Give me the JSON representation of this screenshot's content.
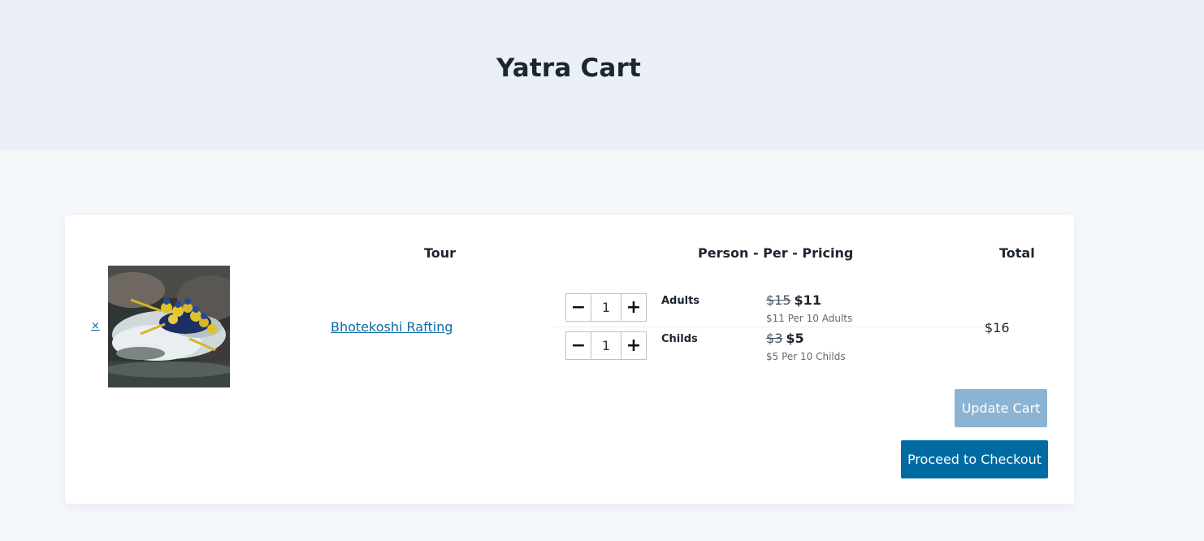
{
  "page": {
    "title": "Yatra Cart"
  },
  "table": {
    "headers": {
      "tour": "Tour",
      "pricing": "Person - Per - Pricing",
      "total": "Total"
    }
  },
  "cart_item": {
    "remove_label": "×",
    "tour_name": "Bhotekoshi Rafting",
    "total": "$16",
    "pricing": [
      {
        "label": "Adults",
        "quantity": "1",
        "old_price": "$15",
        "new_price": "$11",
        "note": "$11 Per 10 Adults"
      },
      {
        "label": "Childs",
        "quantity": "1",
        "old_price": "$3",
        "new_price": "$5",
        "note": "$5 Per 10 Childs"
      }
    ]
  },
  "stepper": {
    "minus": "−",
    "plus": "+"
  },
  "actions": {
    "update_label": "Update Cart",
    "checkout_label": "Proceed to Checkout"
  },
  "colors": {
    "accent": "#006ba3",
    "accent_light": "#8cb4d2",
    "hero_bg": "#ebf0f8",
    "link": "#0a6aa3"
  }
}
